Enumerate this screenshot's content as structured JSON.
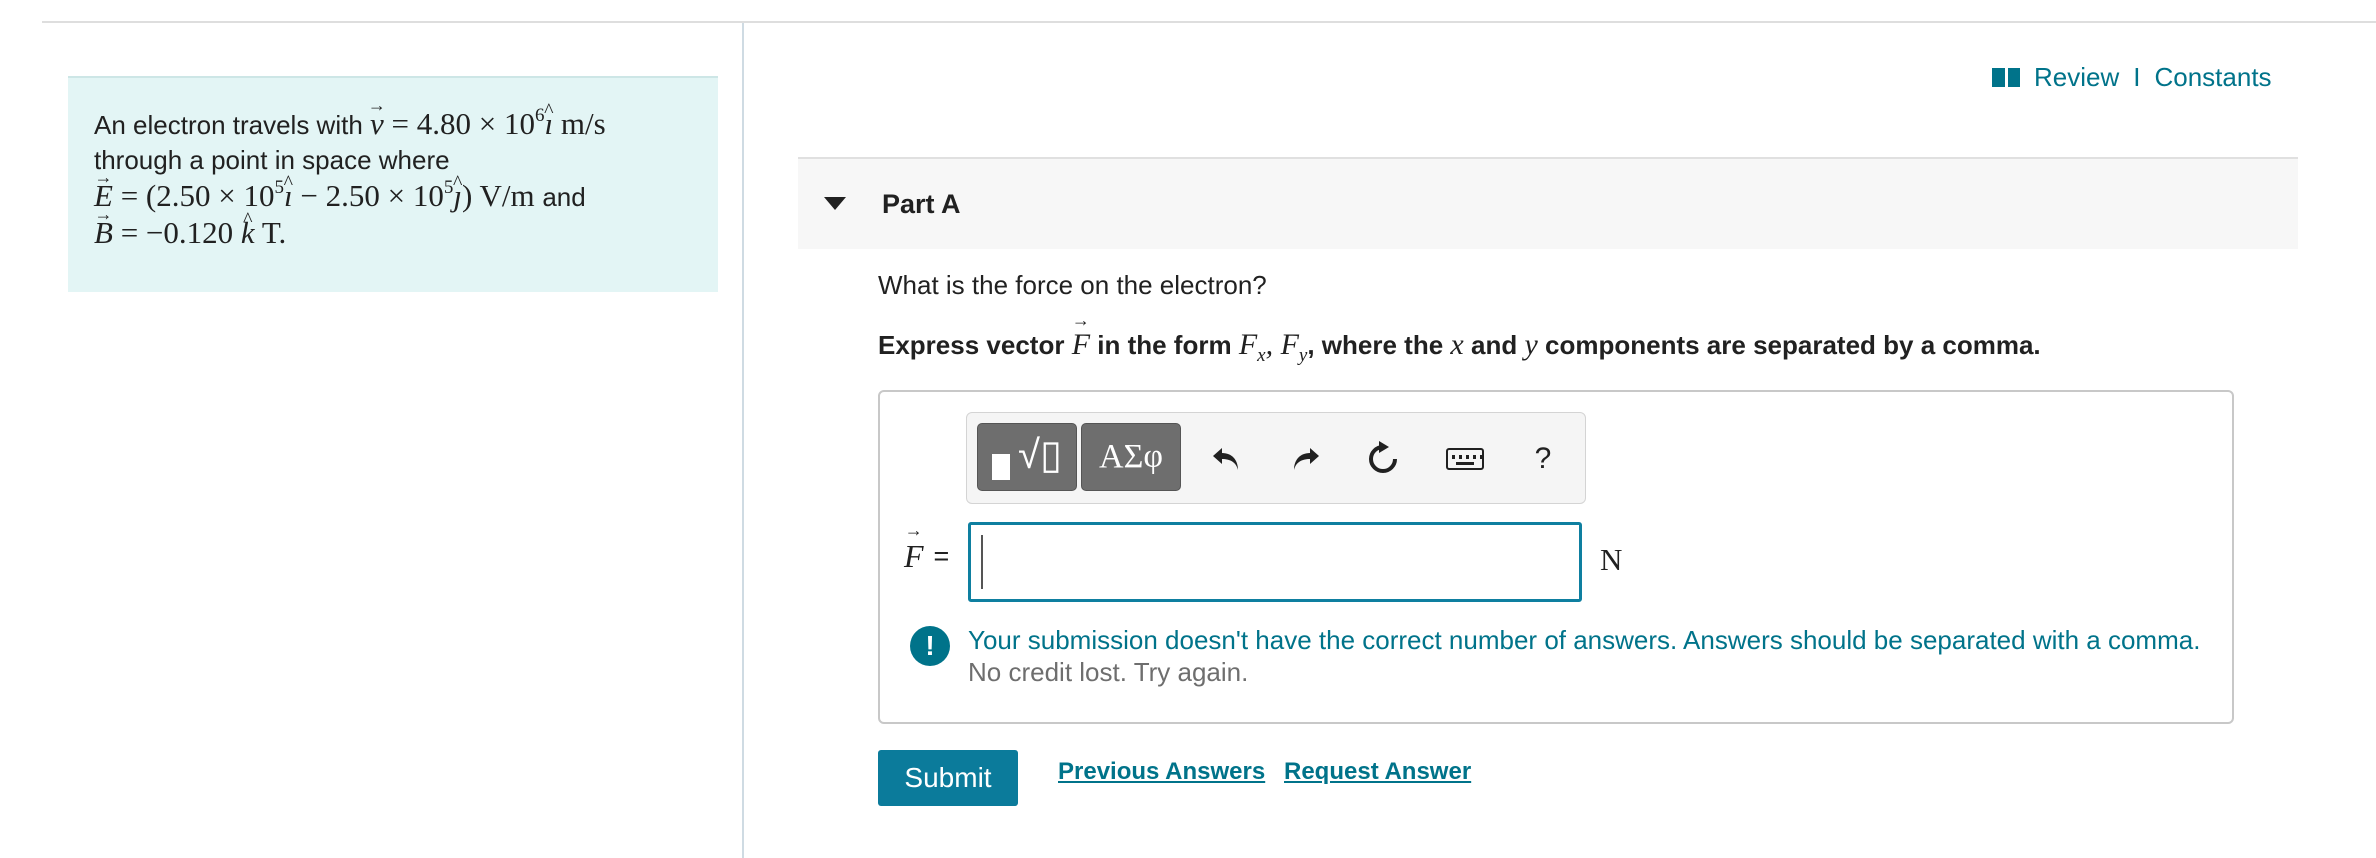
{
  "header": {
    "review_link": "Review",
    "separator": "I",
    "constants_link": "Constants",
    "book_icon": "book-icon"
  },
  "problem": {
    "intro": "An electron travels with",
    "velocity_eq": "= 4.80 × 10",
    "velocity_exp": "6",
    "velocity_unit": "m/s",
    "line2": "through a point in space where",
    "e_eq_a": "= (2.50 × 10",
    "e_exp_a": "5",
    "e_eq_b": "− 2.50 × 10",
    "e_exp_b": "5",
    "e_eq_c": ") V/m",
    "and_text": "and",
    "b_eq": "= −0.120",
    "b_unit": "T.",
    "sym_v": "v",
    "sym_E": "E",
    "sym_B": "B",
    "sym_i": "ı",
    "sym_j": "ȷ",
    "sym_k": "k"
  },
  "part": {
    "title": "Part A",
    "question": "What is the force on the electron?",
    "instruction_1": "Express vector",
    "instruction_sym": "F",
    "instruction_2": "in the form",
    "instruction_form": "F",
    "instruction_sub_x": "x",
    "instruction_comma": ", F",
    "instruction_sub_y": "y",
    "instruction_3": ", where the",
    "instruction_x": "x",
    "instruction_4": "and",
    "instruction_y": "y",
    "instruction_5": "components are separated by a comma."
  },
  "toolbar": {
    "templates_icon": "templates-icon",
    "greek_label": "ΑΣφ",
    "undo_icon": "undo-icon",
    "redo_icon": "redo-icon",
    "reset_icon": "reset-icon",
    "keyboard_icon": "keyboard-icon",
    "help_label": "?"
  },
  "answer": {
    "label_sym": "F",
    "label_eq": "=",
    "value": "",
    "unit": "N"
  },
  "feedback": {
    "icon": "alert-icon",
    "message": "Your submission doesn't have the correct number of answers. Answers should be separated with a comma.",
    "sub": "No credit lost. Try again."
  },
  "actions": {
    "submit": "Submit",
    "previous_answers": "Previous Answers",
    "request_answer": "Request Answer"
  },
  "colors": {
    "accent": "#00738a",
    "submit_bg": "#0b7b9b",
    "problem_bg": "#e3f5f5",
    "input_border": "#0e7fa0"
  }
}
